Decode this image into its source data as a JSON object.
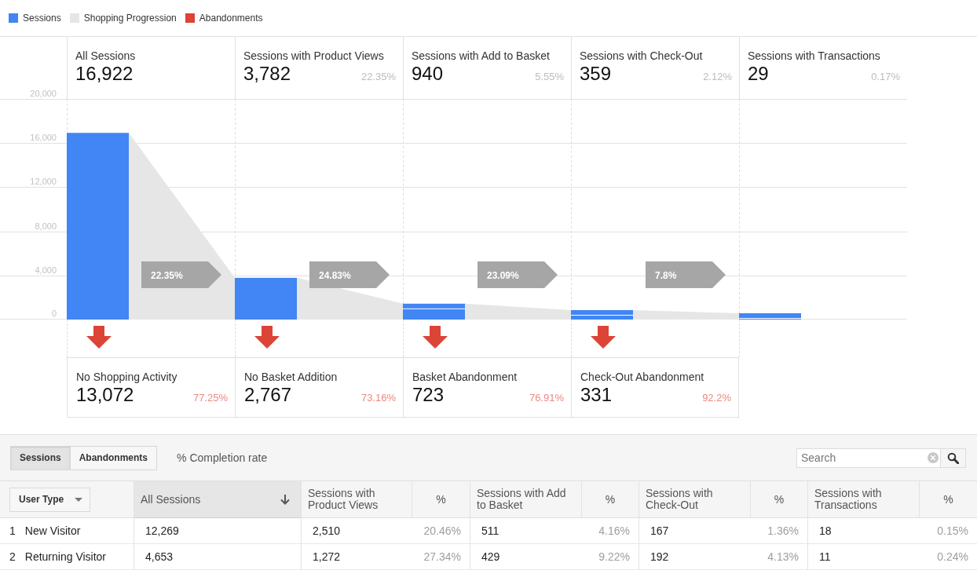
{
  "legend": [
    {
      "label": "Sessions",
      "color": "#4285f4"
    },
    {
      "label": "Shopping Progression",
      "color": "#e6e6e6"
    },
    {
      "label": "Abandonments",
      "color": "#db4437"
    }
  ],
  "funnel": {
    "stages": [
      {
        "title": "All Sessions",
        "value": "16,922",
        "rate": "22.35%"
      },
      {
        "title": "Sessions with Product Views",
        "value": "3,782",
        "percent": "22.35%",
        "rate": "24.83%"
      },
      {
        "title": "Sessions with Add to Basket",
        "value": "940",
        "percent": "5.55%",
        "rate": "23.09%"
      },
      {
        "title": "Sessions with Check-Out",
        "value": "359",
        "percent": "2.12%",
        "rate": "7.8%"
      },
      {
        "title": "Sessions with Transactions",
        "value": "29",
        "percent": "0.17%"
      }
    ],
    "chart_data": {
      "type": "bar",
      "values": [
        16922,
        3782,
        940,
        359,
        29
      ],
      "ylim": [
        0,
        20000
      ],
      "yticks": [
        {
          "value": 0,
          "label": "0"
        },
        {
          "value": 4000,
          "label": "4,000"
        },
        {
          "value": 8000,
          "label": "8,000"
        },
        {
          "value": 12000,
          "label": "12,000"
        },
        {
          "value": 16000,
          "label": "16,000"
        },
        {
          "value": 20000,
          "label": "20,000"
        }
      ],
      "grid": true
    },
    "abandonments": [
      {
        "title": "No Shopping Activity",
        "value": "13,072",
        "percent": "77.25%"
      },
      {
        "title": "No Basket Addition",
        "value": "2,767",
        "percent": "73.16%"
      },
      {
        "title": "Basket Abandonment",
        "value": "723",
        "percent": "76.91%"
      },
      {
        "title": "Check-Out Abandonment",
        "value": "331",
        "percent": "92.2%"
      }
    ]
  },
  "toolbar": {
    "view_toggle": [
      {
        "label": "Sessions",
        "selected": true
      },
      {
        "label": "Abandonments",
        "selected": false
      }
    ],
    "completion_rate": "% Completion rate",
    "search": {
      "placeholder": "Search"
    }
  },
  "table": {
    "columns": [
      {
        "label": "User Type",
        "kind": "dimension",
        "sorted": false
      },
      {
        "label": "All Sessions",
        "kind": "count",
        "sorted": true
      },
      {
        "label": "Sessions with Product Views",
        "kind": "count",
        "sorted": false
      },
      {
        "label": "%",
        "kind": "percent",
        "sorted": false
      },
      {
        "label": "Sessions with Add to Basket",
        "kind": "count",
        "sorted": false
      },
      {
        "label": "%",
        "kind": "percent",
        "sorted": false
      },
      {
        "label": "Sessions with Check-Out",
        "kind": "count",
        "sorted": false
      },
      {
        "label": "%",
        "kind": "percent",
        "sorted": false
      },
      {
        "label": "Sessions with Transactions",
        "kind": "count",
        "sorted": false
      },
      {
        "label": "%",
        "kind": "percent",
        "sorted": false
      }
    ],
    "rows": [
      {
        "number": "1",
        "cells": [
          "New Visitor",
          "12,269",
          "2,510",
          "20.46%",
          "511",
          "4.16%",
          "167",
          "1.36%",
          "18",
          "0.15%"
        ]
      },
      {
        "number": "2",
        "cells": [
          "Returning Visitor",
          "4,653",
          "1,272",
          "27.34%",
          "429",
          "9.22%",
          "192",
          "4.13%",
          "11",
          "0.24%"
        ]
      }
    ]
  }
}
